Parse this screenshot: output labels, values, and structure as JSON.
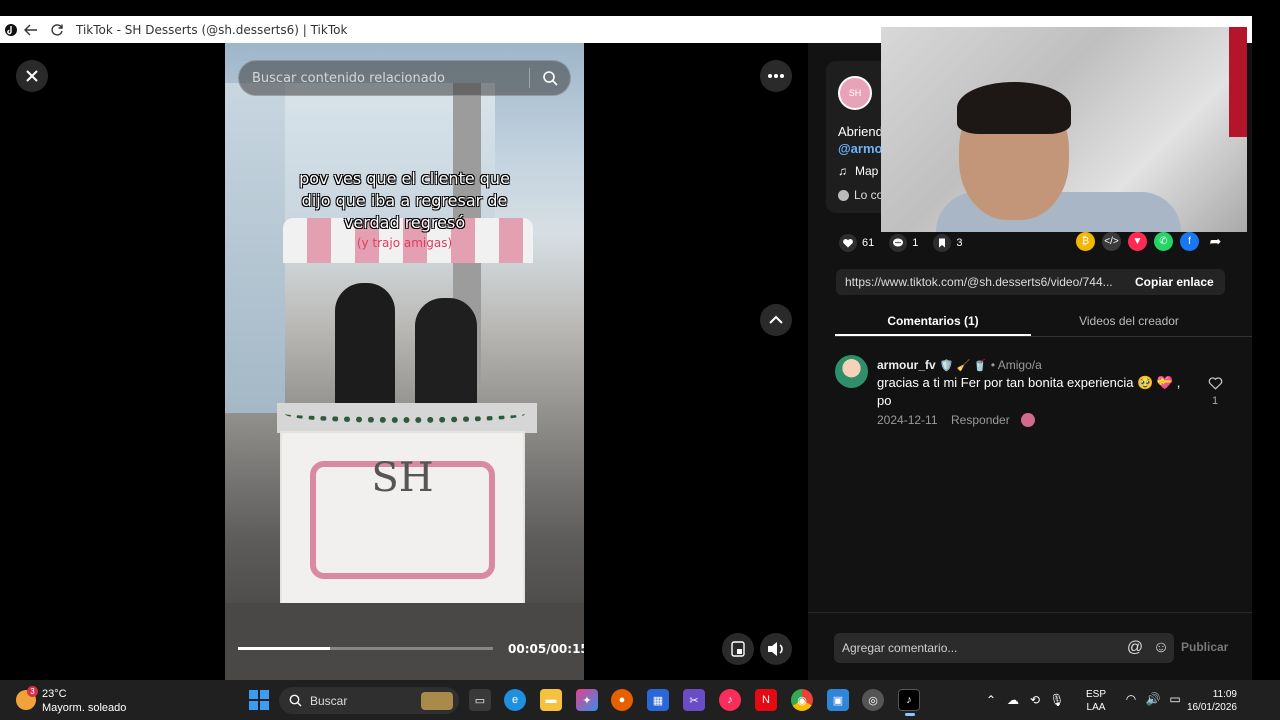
{
  "browser": {
    "tab_title": "TikTok - SH Desserts (@sh.desserts6) | TikTok"
  },
  "video": {
    "search_placeholder": "Buscar contenido relacionado",
    "caption_main": "pov ves que el cliente que\ndijo que iba a regresar de\nverdad regresó",
    "caption_sub": "(y trajo amigas)",
    "cart_logo": "SH",
    "progress_fraction": 0.36,
    "timecode": "00:05/00:15"
  },
  "post": {
    "description": "Abriend",
    "mention": "@armo",
    "music": "Map",
    "lo_co": "Lo co",
    "avatar_text": "SH"
  },
  "actions": {
    "likes": "61",
    "comments": "1",
    "saves": "3"
  },
  "share_icons": [
    "coin-icon",
    "embed-icon",
    "send-icon",
    "whatsapp-icon",
    "facebook-icon",
    "share-arrow-icon"
  ],
  "link": {
    "url": "https://www.tiktok.com/@sh.desserts6/video/744...",
    "copy_label": "Copiar enlace"
  },
  "tabs": [
    {
      "label": "Comentarios (1)",
      "active": true
    },
    {
      "label": "Videos del creador",
      "active": false
    }
  ],
  "comment": {
    "user": "armour_fv",
    "emojis": "🛡️ 🧹 🥤",
    "friend_label": "• Amigo/a",
    "text": "gracias a ti mi Fer por tan bonita experiencia 🥹 💝 , po",
    "date": "2024-12-11",
    "reply_label": "Responder",
    "like_count": "1"
  },
  "composer": {
    "placeholder": "Agregar comentario...",
    "publish_label": "Publicar"
  },
  "taskbar": {
    "weather_temp": "23°C",
    "weather_cond": "Mayorm. soleado",
    "weather_badge": "3",
    "search_label": "Buscar",
    "lang_line1": "ESP",
    "lang_line2": "LAA",
    "time": "11:09",
    "date": "16/01/2026"
  },
  "colors": {
    "accent_link": "#6ab3ff",
    "overlay_sub": "#e23a5a",
    "panel_bg": "#121212"
  }
}
